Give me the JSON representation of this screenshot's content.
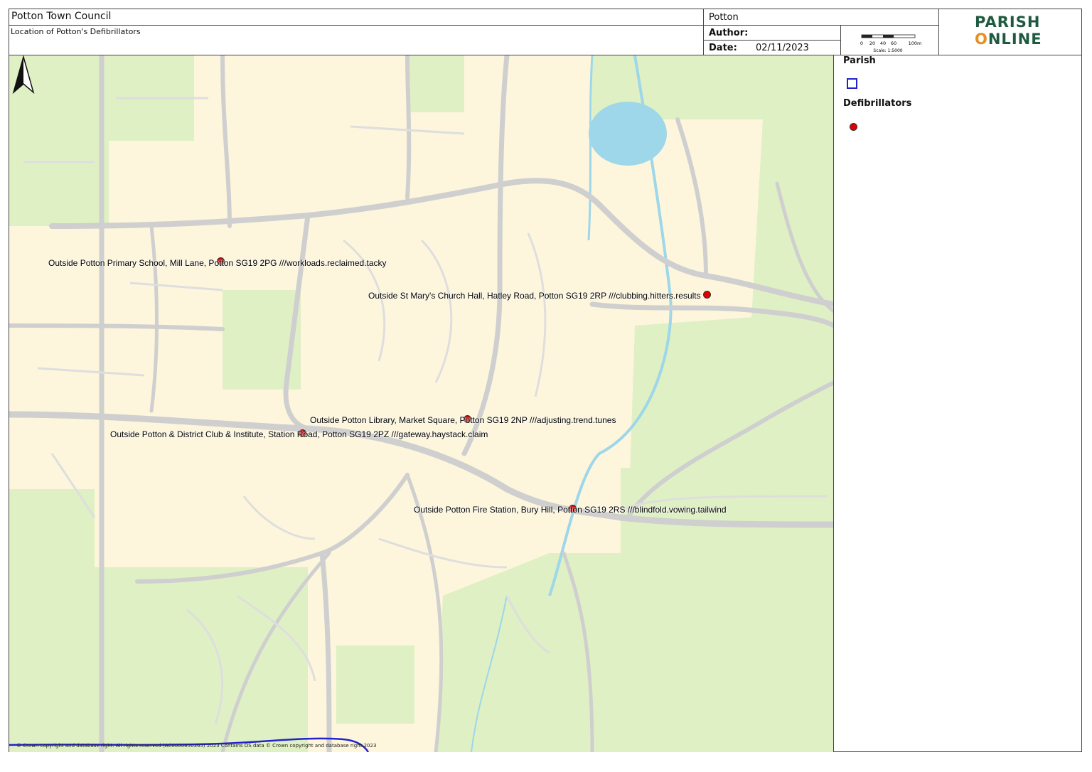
{
  "header": {
    "council": "Potton Town Council",
    "subtitle": "Location of Potton's Defibrillators",
    "parish": "Potton",
    "author_label": "Author:",
    "author_value": "",
    "date_label": "Date:",
    "date_value": "02/11/2023"
  },
  "scalebar": {
    "ticks": [
      "0",
      "20",
      "40",
      "60",
      "100m"
    ],
    "scale_text": "Scale: 1:5000"
  },
  "logo": {
    "line1": "PARISH",
    "line2_o": "O",
    "line2_rest": "NLINE"
  },
  "legend": {
    "parish_label": "Parish",
    "defib_label": "Defibrillators"
  },
  "markers": [
    {
      "label": "Outside Potton Primary School, Mill Lane, Potton SG19 2PG ///workloads.reclaimed.tacky"
    },
    {
      "label": "Outside St Mary's Church Hall, Hatley Road, Potton SG19 2RP ///clubbing.hitters.results"
    },
    {
      "label": "Outside Potton Library, Market Square, Potton SG19 2NP ///adjusting.trend.tunes"
    },
    {
      "label": "Outside Potton & District Club & Institute, Station Road, Potton SG19 2PZ ///gateway.haystack.claim"
    },
    {
      "label": "Outside Potton Fire Station, Bury Hill, Potton SG19 2RS ///blindfold.vowing.tailwind"
    }
  ],
  "copyright": "© Crown copyright and database right. All rights reserved (AC0000850365) 2023 Contains OS data © Crown copyright and database right 2023",
  "colors": {
    "built_up": "#fdf6dc",
    "green_space": "#dff0c4",
    "road": "#d4d4d4",
    "water": "#9ed6ea",
    "marker": "#e00000",
    "parish_boundary": "#2222cc"
  }
}
